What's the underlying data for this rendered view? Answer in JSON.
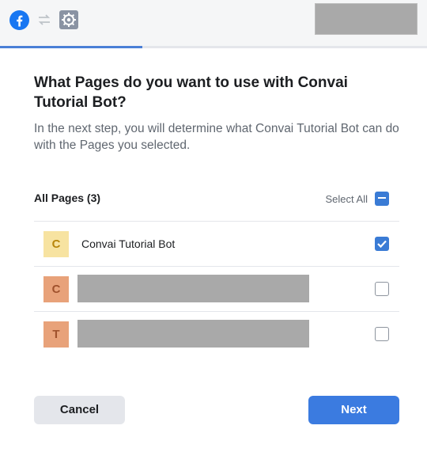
{
  "header": {
    "icons": [
      "facebook-icon",
      "swap-icon",
      "app-gear-icon"
    ],
    "progress_fraction": 0.333,
    "colors": {
      "accent": "#3b7be0",
      "progress": "#4a7fd6"
    }
  },
  "dialog": {
    "title": "What Pages do you want to use with Convai Tutorial Bot?",
    "subtitle": "In the next step, you will determine what Convai Tutorial Bot can do with the Pages you selected."
  },
  "list": {
    "header_label": "All Pages (3)",
    "select_all_label": "Select All",
    "select_all_state": "indeterminate",
    "items": [
      {
        "initial": "C",
        "label": "Convai Tutorial Bot",
        "checked": true,
        "avatar_bg": "#f7e3a1",
        "avatar_fg": "#b8860b"
      },
      {
        "initial": "C",
        "label": "",
        "checked": false,
        "avatar_bg": "#e8a27a",
        "avatar_fg": "#a0522d"
      },
      {
        "initial": "T",
        "label": "",
        "checked": false,
        "avatar_bg": "#e8a27a",
        "avatar_fg": "#a0522d"
      }
    ]
  },
  "footer": {
    "cancel_label": "Cancel",
    "next_label": "Next"
  }
}
